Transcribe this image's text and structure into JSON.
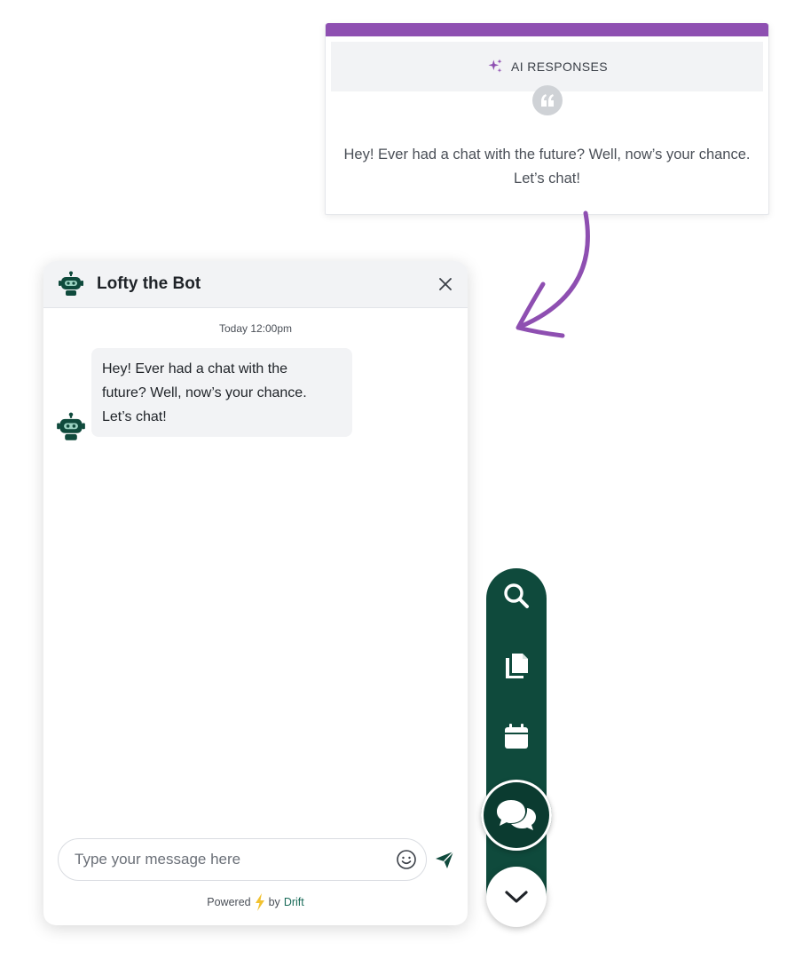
{
  "ai_card": {
    "title": "AI RESPONSES",
    "text": "Hey! Ever had a chat with the future? Well, now’s your chance. Let’s chat!",
    "accent_color": "#8e4fb1",
    "icons": [
      "sparkle-icon",
      "quote-icon"
    ]
  },
  "chat": {
    "bot_name": "Lofty the Bot",
    "timestamp": "Today 12:00pm",
    "message": {
      "line1": "Hey! Ever had a chat with the",
      "line2": "future? Well, now’s your chance.",
      "line3": "Let’s chat!"
    },
    "input_placeholder": "Type your message here",
    "powered_prefix": "Powered",
    "powered_by": "by",
    "powered_brand": "Drift",
    "brand_color": "#0f4a3c"
  },
  "launcher": {
    "items": [
      "search-icon",
      "documents-icon",
      "calendar-icon",
      "chat-bubbles-icon",
      "chevron-down-icon"
    ]
  }
}
